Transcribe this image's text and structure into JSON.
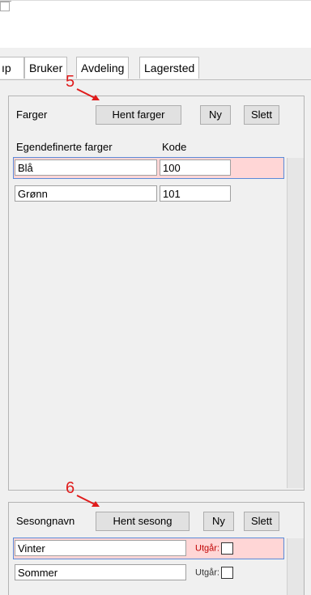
{
  "window": {
    "minimize_icon": "minimize-icon",
    "maximize_icon": "maximize-icon"
  },
  "tabs": [
    "ıp",
    "Bruker",
    "Avdeling",
    "Lagersted"
  ],
  "colors_panel": {
    "title": "Farger",
    "fetch_button": "Hent farger",
    "new_button": "Ny",
    "delete_button": "Slett",
    "col_custom": "Egendefinerte farger",
    "col_code": "Kode",
    "rows": [
      {
        "name": "Blå",
        "code": "100"
      },
      {
        "name": "Grønn",
        "code": "101"
      }
    ]
  },
  "season_panel": {
    "title": "Sesongnavn",
    "fetch_button": "Hent sesong",
    "new_button": "Ny",
    "delete_button": "Slett",
    "expired_label": "Utgår:",
    "rows": [
      {
        "name": "Vinter"
      },
      {
        "name": "Sommer"
      }
    ]
  },
  "annotations": {
    "five": "5",
    "six": "6"
  },
  "colors": {
    "annotation": "#e01b1b",
    "highlight": "#ffd6d6",
    "selection_border": "#5b8ad8"
  }
}
